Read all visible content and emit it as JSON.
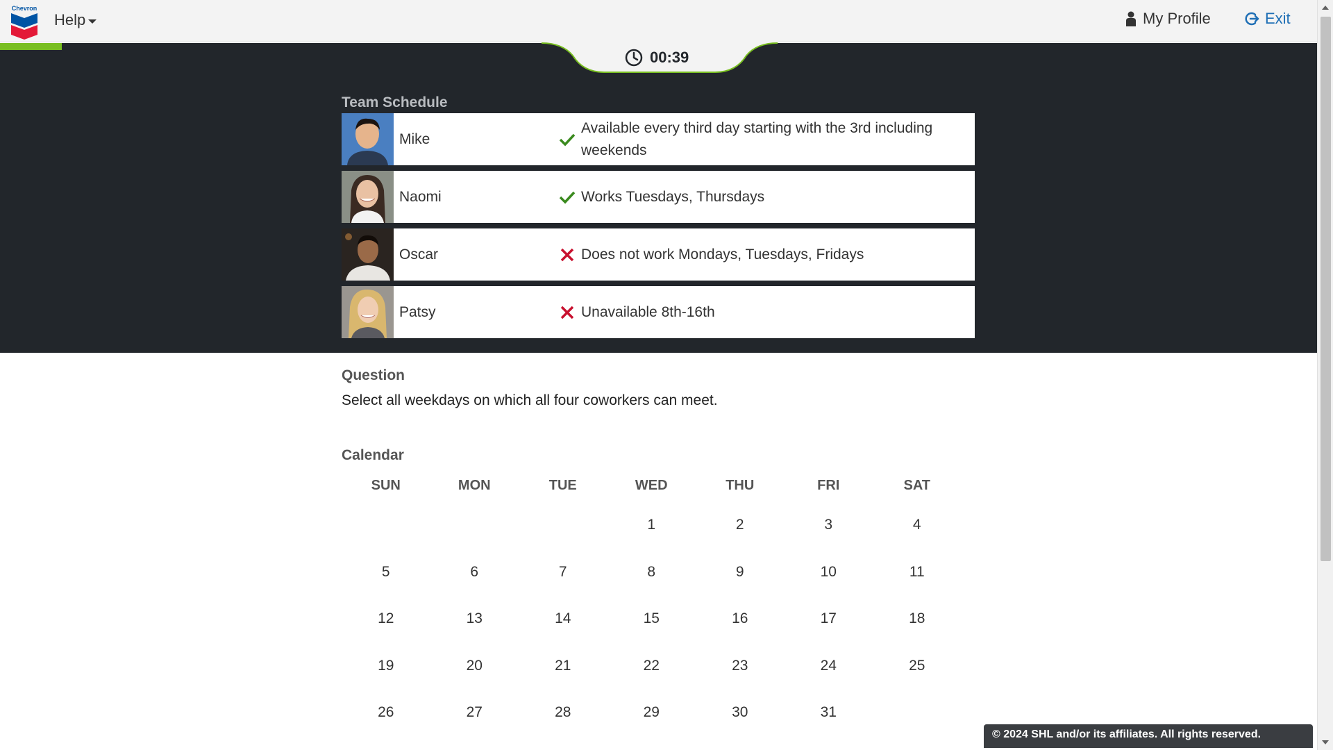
{
  "header": {
    "help_label": "Help",
    "profile_label": "My Profile",
    "exit_label": "Exit",
    "logo_text": "Chevron"
  },
  "timer": {
    "value": "00:39"
  },
  "progress": {
    "fraction": 0.047
  },
  "schedule": {
    "title": "Team Schedule",
    "members": [
      {
        "name": "Mike",
        "status": "check",
        "text": "Available every third day starting with the 3rd including weekends"
      },
      {
        "name": "Naomi",
        "status": "check",
        "text": "Works Tuesdays, Thursdays"
      },
      {
        "name": "Oscar",
        "status": "cross",
        "text": "Does not work Mondays, Tuesdays, Fridays"
      },
      {
        "name": "Patsy",
        "status": "cross",
        "text": "Unavailable 8th-16th"
      }
    ]
  },
  "question": {
    "label": "Question",
    "text": "Select all weekdays on which all four coworkers can meet."
  },
  "calendar": {
    "label": "Calendar",
    "weekdays": [
      "SUN",
      "MON",
      "TUE",
      "WED",
      "THU",
      "FRI",
      "SAT"
    ],
    "days": [
      "",
      "",
      "",
      "1",
      "2",
      "3",
      "4",
      "5",
      "6",
      "7",
      "8",
      "9",
      "10",
      "11",
      "12",
      "13",
      "14",
      "15",
      "16",
      "17",
      "18",
      "19",
      "20",
      "21",
      "22",
      "23",
      "24",
      "25",
      "26",
      "27",
      "28",
      "29",
      "30",
      "31",
      ""
    ]
  },
  "footer": {
    "copyright": "© 2024 SHL and/or its affiliates. All rights reserved."
  },
  "colors": {
    "accent_green": "#78be20",
    "check": "#3a8a1e",
    "cross": "#c8102e",
    "link": "#1f6fb5",
    "dark_band": "#22262b"
  }
}
